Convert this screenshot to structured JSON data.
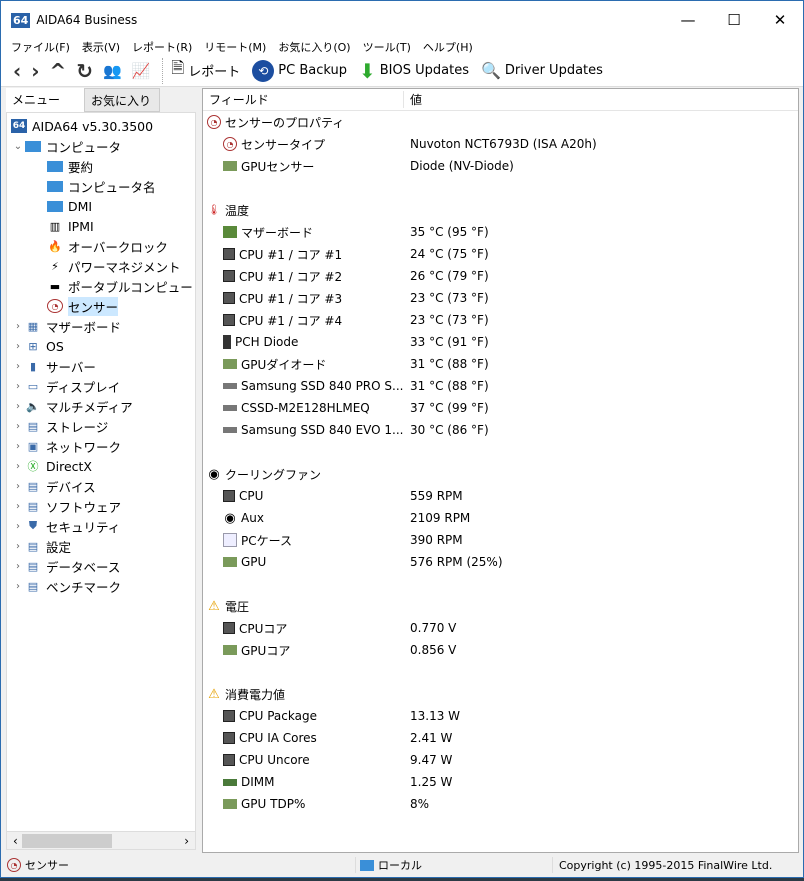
{
  "window": {
    "title": "AIDA64 Business",
    "logo": "64",
    "minimize": "—",
    "maximize": "☐",
    "close": "✕"
  },
  "menu": [
    "ファイル(F)",
    "表示(V)",
    "レポート(R)",
    "リモート(M)",
    "お気に入り(O)",
    "ツール(T)",
    "ヘルプ(H)"
  ],
  "toolbar": {
    "nav": [
      "‹",
      "›",
      "^",
      "↻",
      "👥",
      "📈"
    ],
    "report": "レポート",
    "pcbackup": "PC Backup",
    "bios": "BIOS Updates",
    "driver": "Driver Updates"
  },
  "tabs": {
    "menu": "メニュー",
    "favorites": "お気に入り"
  },
  "tree": {
    "root": "AIDA64 v5.30.3500",
    "computer": "コンピュータ",
    "children": [
      "要約",
      "コンピュータ名",
      "DMI",
      "IPMI",
      "オーバークロック",
      "パワーマネジメント",
      "ポータブルコンピュー",
      "センサー"
    ],
    "groups": [
      "マザーボード",
      "OS",
      "サーバー",
      "ディスプレイ",
      "マルチメディア",
      "ストレージ",
      "ネットワーク",
      "DirectX",
      "デバイス",
      "ソフトウェア",
      "セキュリティ",
      "設定",
      "データベース",
      "ベンチマーク"
    ]
  },
  "columns": {
    "field": "フィールド",
    "value": "値"
  },
  "sections": [
    {
      "title": "センサーのプロパティ",
      "icon": "gauge",
      "rows": [
        {
          "f": "センサータイプ",
          "v": "Nuvoton NCT6793D  (ISA A20h)",
          "icon": "gauge"
        },
        {
          "f": "GPUセンサー",
          "v": "Diode  (NV-Diode)",
          "icon": "gpu"
        }
      ]
    },
    {
      "title": "温度",
      "icon": "thermo",
      "rows": [
        {
          "f": "マザーボード",
          "v": "35 °C  (95 °F)",
          "icon": "board"
        },
        {
          "f": "CPU #1 / コア #1",
          "v": "24 °C  (75 °F)",
          "icon": "chip"
        },
        {
          "f": "CPU #1 / コア #2",
          "v": "26 °C  (79 °F)",
          "icon": "chip"
        },
        {
          "f": "CPU #1 / コア #3",
          "v": "23 °C  (73 °F)",
          "icon": "chip"
        },
        {
          "f": "CPU #1 / コア #4",
          "v": "23 °C  (73 °F)",
          "icon": "chip"
        },
        {
          "f": "PCH Diode",
          "v": "33 °C  (91 °F)",
          "icon": "pch"
        },
        {
          "f": "GPUダイオード",
          "v": "31 °C  (88 °F)",
          "icon": "gpu"
        },
        {
          "f": "Samsung SSD 840 PRO S...",
          "v": "31 °C  (88 °F)",
          "icon": "disk"
        },
        {
          "f": "CSSD-M2E128HLMEQ",
          "v": "37 °C  (99 °F)",
          "icon": "disk"
        },
        {
          "f": "Samsung SSD 840 EVO 1...",
          "v": "30 °C  (86 °F)",
          "icon": "disk"
        }
      ]
    },
    {
      "title": "クーリングファン",
      "icon": "fan",
      "rows": [
        {
          "f": "CPU",
          "v": "559 RPM",
          "icon": "chip"
        },
        {
          "f": "Aux",
          "v": "2109 RPM",
          "icon": "fan"
        },
        {
          "f": "PCケース",
          "v": "390 RPM",
          "icon": "case"
        },
        {
          "f": "GPU",
          "v": "576 RPM  (25%)",
          "icon": "gpu"
        }
      ]
    },
    {
      "title": "電圧",
      "icon": "warn",
      "rows": [
        {
          "f": "CPUコア",
          "v": "0.770 V",
          "icon": "chip"
        },
        {
          "f": "GPUコア",
          "v": "0.856 V",
          "icon": "gpu"
        }
      ]
    },
    {
      "title": "消費電力値",
      "icon": "warn",
      "rows": [
        {
          "f": "CPU Package",
          "v": "13.13 W",
          "icon": "chip"
        },
        {
          "f": "CPU IA Cores",
          "v": "2.41 W",
          "icon": "chip"
        },
        {
          "f": "CPU Uncore",
          "v": "9.47 W",
          "icon": "chip"
        },
        {
          "f": "DIMM",
          "v": "1.25 W",
          "icon": "dimm"
        },
        {
          "f": "GPU TDP%",
          "v": "8%",
          "icon": "gpu"
        }
      ]
    }
  ],
  "status": {
    "left": "センサー",
    "mid": "ローカル",
    "right": "Copyright (c) 1995-2015 FinalWire Ltd."
  }
}
